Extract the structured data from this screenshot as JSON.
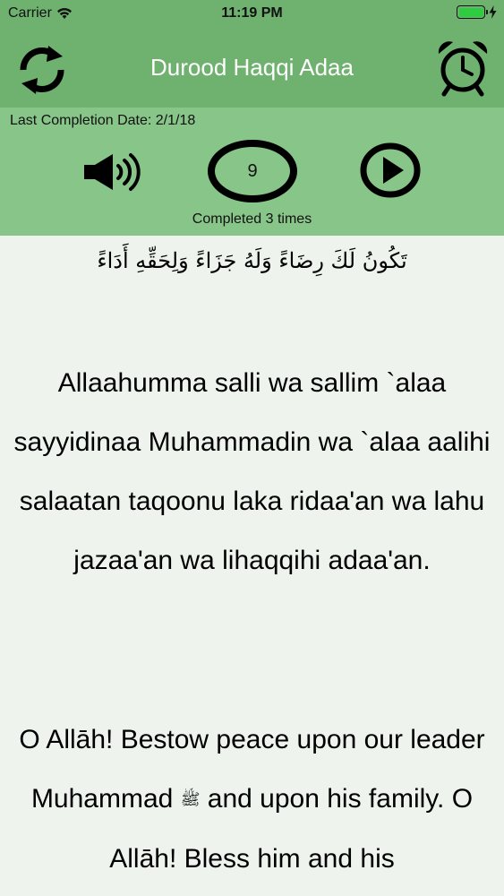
{
  "status": {
    "carrier": "Carrier",
    "time": "11:19 PM"
  },
  "nav": {
    "title": "Durood Haqqi Adaa",
    "left_icon": "refresh-icon",
    "right_icon": "alarm-clock-icon",
    "color": "#6fb26f"
  },
  "controls": {
    "last_completion": "Last Completion Date: 2/1/18",
    "counter": "9",
    "completed": "Completed 3 times",
    "speaker_icon": "speaker-icon",
    "play_icon": "play-icon",
    "color": "#88c588"
  },
  "content": {
    "arabic": "تَكُونُ لَكَ رِضَاءً وَلَهُ جَزَاءً وَلِحَقِّهِ أَدَاءً",
    "transliteration": "Allaahumma salli wa sallim `alaa sayyidinaa Muhammadin wa `alaa aalihi salaatan taqoonu laka ridaa'an wa lahu jazaa'an wa lihaqqihi adaa'an.",
    "translation_part1": "O Allāh! Bestow peace upon our leader Muhammad",
    "seal": "ﷺ",
    "translation_part2": "and upon his family. O Allāh! Bless him and his"
  }
}
